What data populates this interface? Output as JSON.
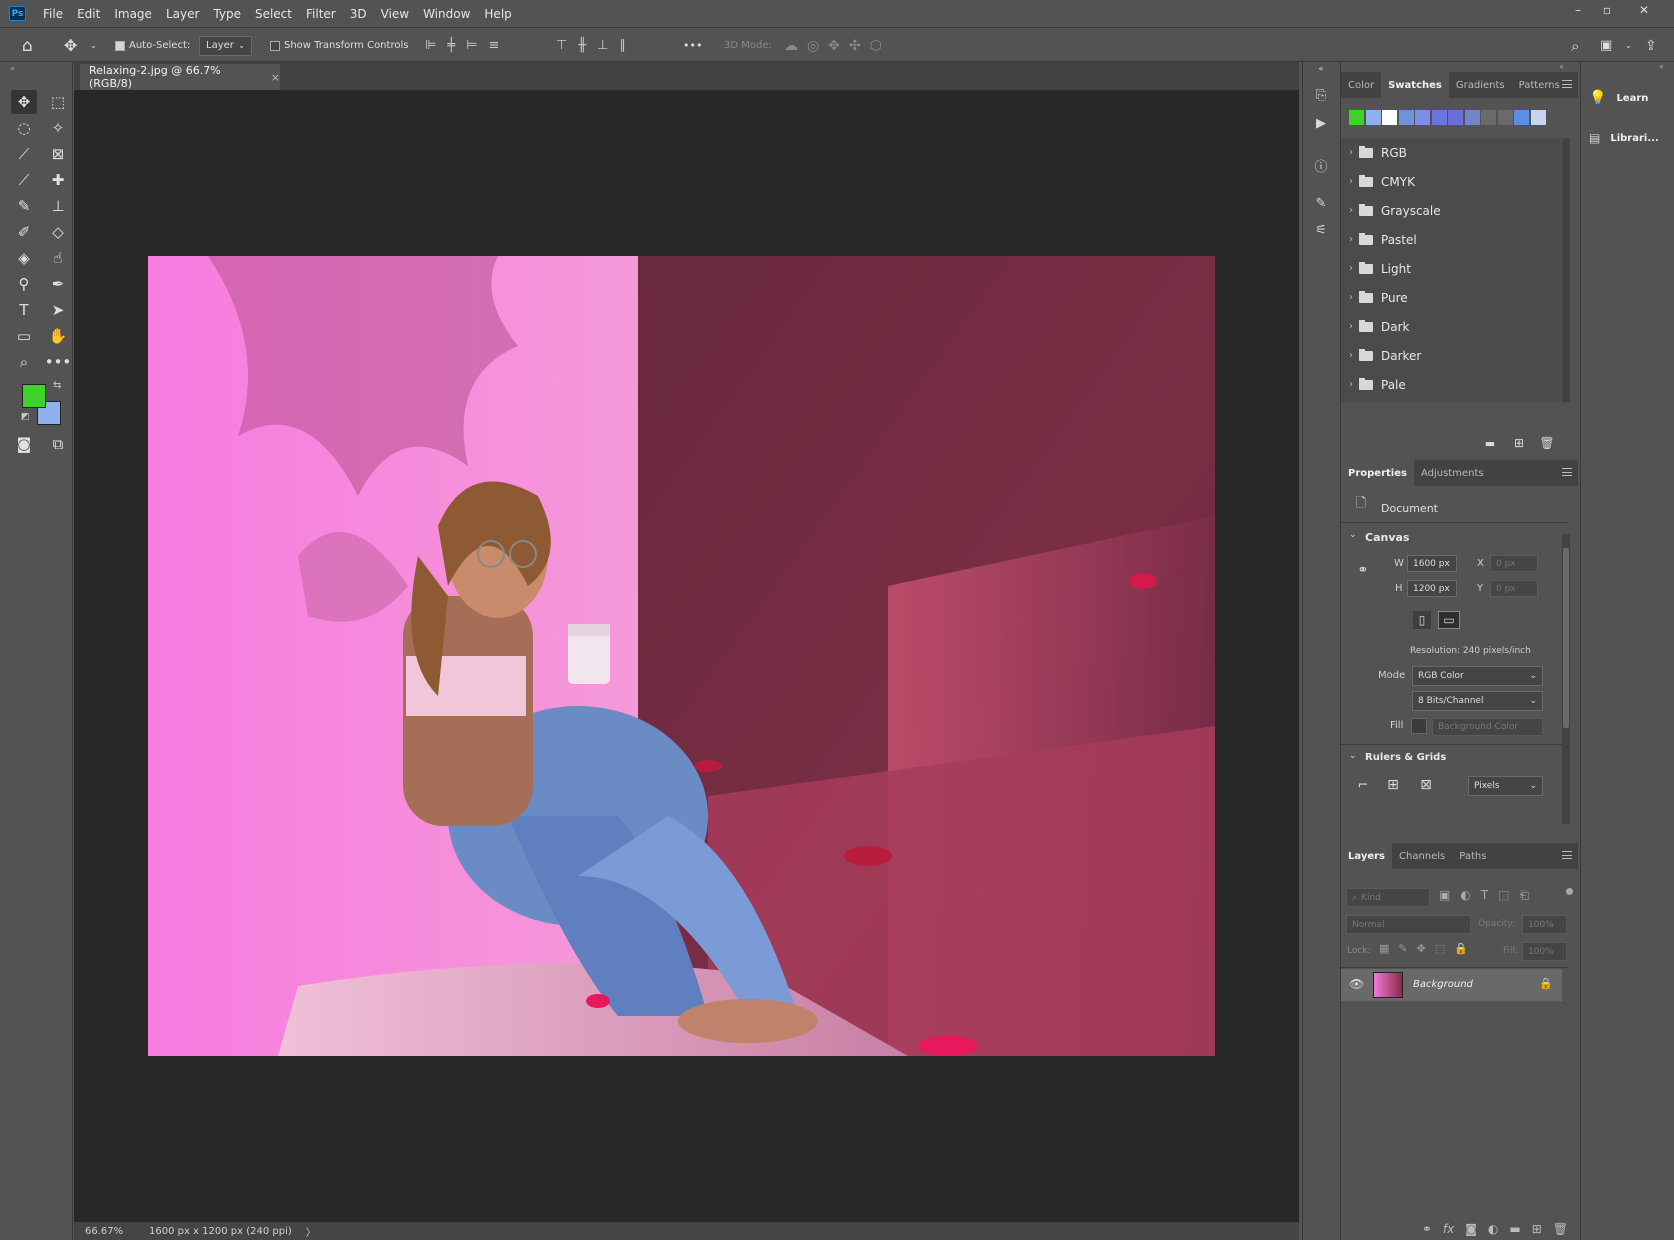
{
  "app": {
    "logo": "Ps"
  },
  "menu": [
    "File",
    "Edit",
    "Image",
    "Layer",
    "Type",
    "Select",
    "Filter",
    "3D",
    "View",
    "Window",
    "Help"
  ],
  "window_controls": {
    "minimize": "–",
    "maximize": "▫",
    "close": "✕"
  },
  "options": {
    "auto_select_label": "Auto-Select:",
    "auto_select_checked": true,
    "auto_select_target": "Layer",
    "show_transform_label": "Show Transform Controls",
    "show_transform_checked": false,
    "more": "•••",
    "mode_3d_label": "3D Mode:"
  },
  "document": {
    "tab_title": "Relaxing-2.jpg @ 66.7% (RGB/8)",
    "tab_close": "×"
  },
  "status": {
    "zoom": "66.67%",
    "info": "1600 px x 1200 px (240 ppi)",
    "arrow": "〉"
  },
  "colors": {
    "foreground": "#3ed22a",
    "background": "#8fb0ee",
    "accent": "#31a8ff"
  },
  "swatches_panel": {
    "tabs": [
      "Color",
      "Swatches",
      "Gradients",
      "Patterns"
    ],
    "active_tab": "Swatches",
    "recent_colors": [
      "#3ed22a",
      "#8fb0ee",
      "#ffffff",
      "#6f93d8",
      "#7d8ee6",
      "#6a76e0",
      "#6a6fd6",
      "#7086c8",
      "#6a6a6a",
      "#6a6a6a",
      "#5b8fe6",
      "#c8d4ee"
    ],
    "groups": [
      "RGB",
      "CMYK",
      "Grayscale",
      "Pastel",
      "Light",
      "Pure",
      "Dark",
      "Darker",
      "Pale"
    ]
  },
  "properties_panel": {
    "tabs": [
      "Properties",
      "Adjustments"
    ],
    "active_tab": "Properties",
    "document_label": "Document",
    "canvas_heading": "Canvas",
    "w_label": "W",
    "w_value": "1600 px",
    "h_label": "H",
    "h_value": "1200 px",
    "x_label": "X",
    "x_value": "0 px",
    "y_label": "Y",
    "y_value": "0 px",
    "resolution": "Resolution: 240 pixels/inch",
    "mode_label": "Mode",
    "mode_value": "RGB Color",
    "bits_value": "8 Bits/Channel",
    "fill_label": "Fill",
    "fill_value": "Background Color",
    "rulers_heading": "Rulers & Grids",
    "units_value": "Pixels"
  },
  "layers_panel": {
    "tabs": [
      "Layers",
      "Channels",
      "Paths"
    ],
    "active_tab": "Layers",
    "filter_placeholder": "Kind",
    "blend_mode": "Normal",
    "opacity_label": "Opacity:",
    "opacity_value": "100%",
    "lock_label": "Lock:",
    "fill_label": "Fill:",
    "fill_value": "100%",
    "layers": [
      {
        "name": "Background",
        "visible": true,
        "locked": true
      }
    ]
  },
  "learn_panel": {
    "learn_label": "Learn",
    "libraries_label": "Librari..."
  }
}
